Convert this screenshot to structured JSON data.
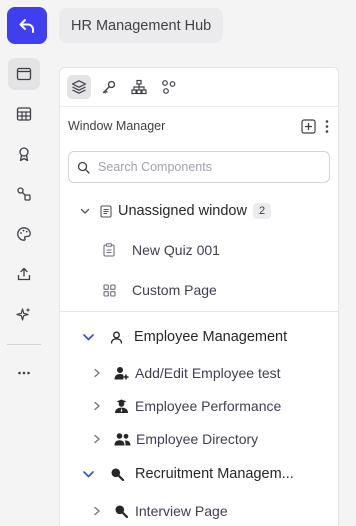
{
  "header": {
    "title": "HR Management Hub"
  },
  "panel": {
    "section_title": "Window Manager",
    "search": {
      "placeholder": "Search Components",
      "value": ""
    }
  },
  "tree": {
    "unassigned": {
      "label": "Unassigned window",
      "count": "2",
      "items": [
        {
          "label": "New Quiz 001",
          "icon": "clipboard-icon"
        },
        {
          "label": "Custom Page",
          "icon": "grid-icon"
        }
      ]
    },
    "groups": [
      {
        "label": "Employee Management",
        "icon": "user-icon",
        "children": [
          {
            "label": "Add/Edit Employee test",
            "icon": "user-plus-icon"
          },
          {
            "label": "Employee Performance",
            "icon": "user-tie-icon"
          },
          {
            "label": "Employee Directory",
            "icon": "users-icon"
          }
        ]
      },
      {
        "label": "Recruitment Managem...",
        "icon": "search-icon",
        "children": [
          {
            "label": "Interview Page",
            "icon": "search-icon"
          }
        ]
      }
    ]
  },
  "colors": {
    "accent": "#3f3ff0",
    "chevron_blue": "#2f4fd6"
  }
}
